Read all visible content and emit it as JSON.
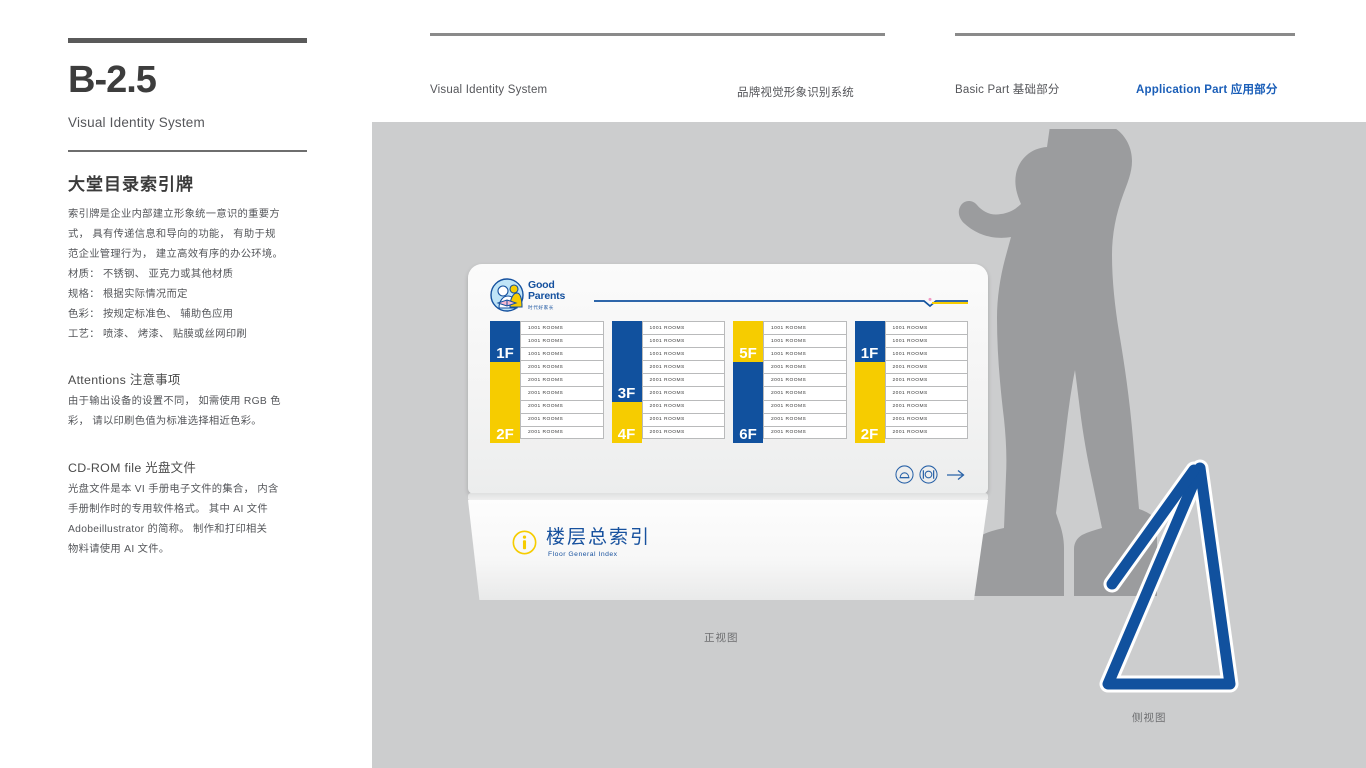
{
  "left": {
    "code": "B-2.5",
    "code_sub": "Visual Identity System",
    "section_title": "大堂目录索引牌",
    "desc_lines": [
      "索引牌是企业内部建立形象统一意识的重要方",
      "式， 具有传递信息和导向的功能， 有助于规",
      "范企业管理行为， 建立高效有序的办公环境。",
      "材质： 不锈钢、 亚克力或其他材质",
      "规格： 根据实际情况而定",
      "色彩： 按规定标准色、 辅助色应用",
      "工艺： 喷漆、 烤漆、 贴膜或丝网印刷"
    ],
    "attentions_head": "Attentions 注意事项",
    "attentions_lines": [
      "由于输出设备的设置不同， 如需使用 RGB 色",
      "彩， 请以印刷色值为标准选择相近色彩。"
    ],
    "cdrom_head": "CD-ROM file 光盘文件",
    "cdrom_lines": [
      "光盘文件是本 VI 手册电子文件的集合， 内含",
      "手册制作时的专用软件格式。 其中 AI 文件",
      "Adobeillustrator 的简称。 制作和打印相关",
      "物料请使用 AI 文件。"
    ]
  },
  "nav": {
    "visual_identity_system": "Visual Identity System",
    "brand_cn": "品牌视觉形象识别系统",
    "basic_part": "Basic Part 基础部分",
    "application_part": "Application Part 应用部分"
  },
  "board": {
    "logo_en_line1": "Good",
    "logo_en_line2": "Parents",
    "logo_cn": "时代好家长",
    "columns": [
      {
        "floors": [
          {
            "label": "1F",
            "color": "#11519e",
            "rooms": [
              "1001  ROOMS",
              "1001  ROOMS",
              "1001  ROOMS"
            ]
          },
          {
            "label": "2F",
            "color": "#f6cc00",
            "rooms": [
              "2001  ROOMS",
              "2001  ROOMS",
              "2001  ROOMS",
              "2001  ROOMS",
              "2001  ROOMS",
              "2001  ROOMS"
            ]
          }
        ]
      },
      {
        "floors": [
          {
            "label": "3F",
            "color": "#11519e",
            "rooms": [
              "1001  ROOMS",
              "1001  ROOMS",
              "1001  ROOMS"
            ]
          },
          {
            "label": "4F",
            "color": "#f6cc00",
            "rooms": [
              "2001  ROOMS",
              "2001  ROOMS",
              "2001  ROOMS",
              "2001  ROOMS",
              "2001  ROOMS",
              "2001  ROOMS"
            ]
          }
        ]
      },
      {
        "floors": [
          {
            "label": "5F",
            "color": "#f6cc00",
            "rooms": [
              "1001  ROOMS",
              "1001  ROOMS",
              "1001  ROOMS"
            ]
          },
          {
            "label": "6F",
            "color": "#11519e",
            "rooms": [
              "2001  ROOMS",
              "2001  ROOMS",
              "2001  ROOMS",
              "2001  ROOMS",
              "2001  ROOMS",
              "2001  ROOMS"
            ]
          }
        ]
      },
      {
        "floors": [
          {
            "label": "1F",
            "color": "#11519e",
            "rooms": [
              "1001  ROOMS",
              "1001  ROOMS",
              "1001  ROOMS"
            ]
          },
          {
            "label": "2F",
            "color": "#f6cc00",
            "rooms": [
              "2001  ROOMS",
              "2001  ROOMS",
              "2001  ROOMS",
              "2001  ROOMS",
              "2001  ROOMS",
              "2001  ROOMS"
            ]
          }
        ]
      }
    ],
    "pictograms": [
      "elevator-icon",
      "restaurant-icon",
      "arrow-right-icon"
    ]
  },
  "base": {
    "index_cn": "楼层总索引",
    "index_en": "Floor General Index",
    "info_icon": "info-circle-icon"
  },
  "captions": {
    "front_view": "正视图",
    "side_view": "侧视图"
  },
  "colors": {
    "brand_blue": "#11519e",
    "brand_yellow": "#f6cc00",
    "stage_grey": "#cccdce",
    "accent_link": "#1a5eb8"
  }
}
